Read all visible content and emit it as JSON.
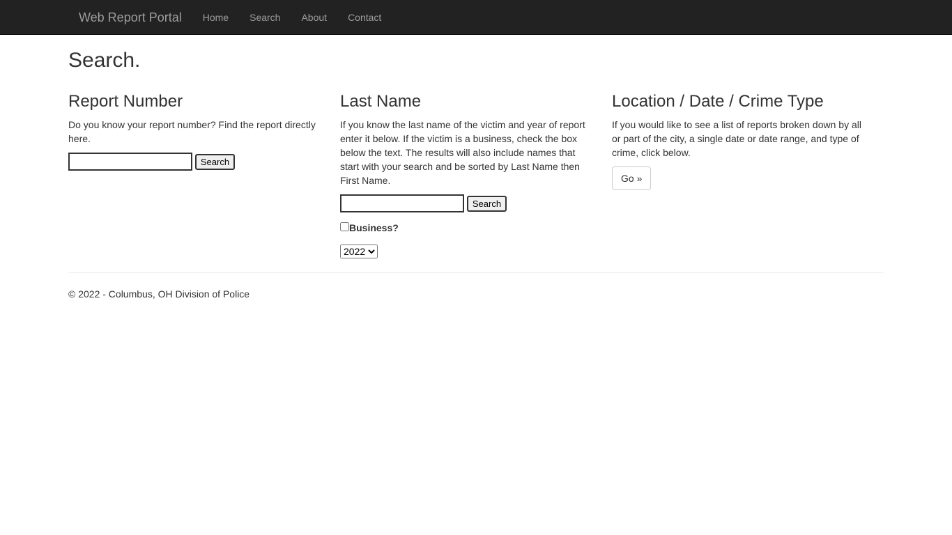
{
  "nav": {
    "brand": "Web Report Portal",
    "links": [
      "Home",
      "Search",
      "About",
      "Contact"
    ]
  },
  "page_title": "Search.",
  "report": {
    "title": "Report Number",
    "text": "Do you know your report number? Find the report directly here.",
    "search_label": "Search",
    "input_value": ""
  },
  "lastname": {
    "title": "Last Name",
    "text": "If you know the last name of the victim and year of report enter it below. If the victim is a business, check the box below the text. The results will also include names that start with your search and be sorted by Last Name then First Name.",
    "search_label": "Search",
    "input_value": "",
    "business_label": "Business?",
    "business_checked": false,
    "year": "2022"
  },
  "location": {
    "title": "Location / Date / Crime Type",
    "text": "If you would like to see a list of reports broken down by all or part of the city, a single date or date range, and type of crime, click below.",
    "go_label": "Go »"
  },
  "footer": "© 2022 - Columbus, OH Division of Police"
}
